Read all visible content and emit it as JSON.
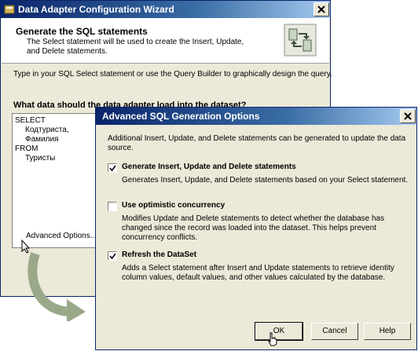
{
  "wizard": {
    "title": "Data Adapter Configuration Wizard",
    "header_title": "Generate the SQL statements",
    "header_desc": "The Select statement will be used to create the Insert, Update, and Delete statements.",
    "instructions": "Type in your SQL Select statement or use the Query Builder to graphically design the query.",
    "question": "What data should the data adapter load into the dataset?",
    "sql_lines": [
      "SELECT",
      "Кодтуриста,",
      "Фамилия",
      "FROM",
      "Туристы"
    ],
    "advanced_options_label": "Advanced Options..."
  },
  "dialog": {
    "title": "Advanced SQL Generation Options",
    "intro": "Additional Insert, Update, and Delete statements can be generated to update the data source.",
    "options": [
      {
        "label": "Generate Insert, Update and Delete statements",
        "checked": true,
        "description": "Generates Insert, Update, and Delete statements based on your Select statement."
      },
      {
        "label": "Use optimistic concurrency",
        "checked": false,
        "description": "Modifies Update and Delete statements to detect whether the database has changed since the record was loaded into the dataset. This helps prevent concurrency conflicts."
      },
      {
        "label": "Refresh the DataSet",
        "checked": true,
        "description": "Adds a Select statement after Insert and Update statements to retrieve identity column values, default values, and other values calculated by the database."
      }
    ],
    "buttons": {
      "ok": "OK",
      "cancel": "Cancel",
      "help": "Help"
    }
  },
  "colors": {
    "titlebar": "#0a246a",
    "window_bg": "#ece9d8",
    "arrow": "#9aa88a"
  }
}
